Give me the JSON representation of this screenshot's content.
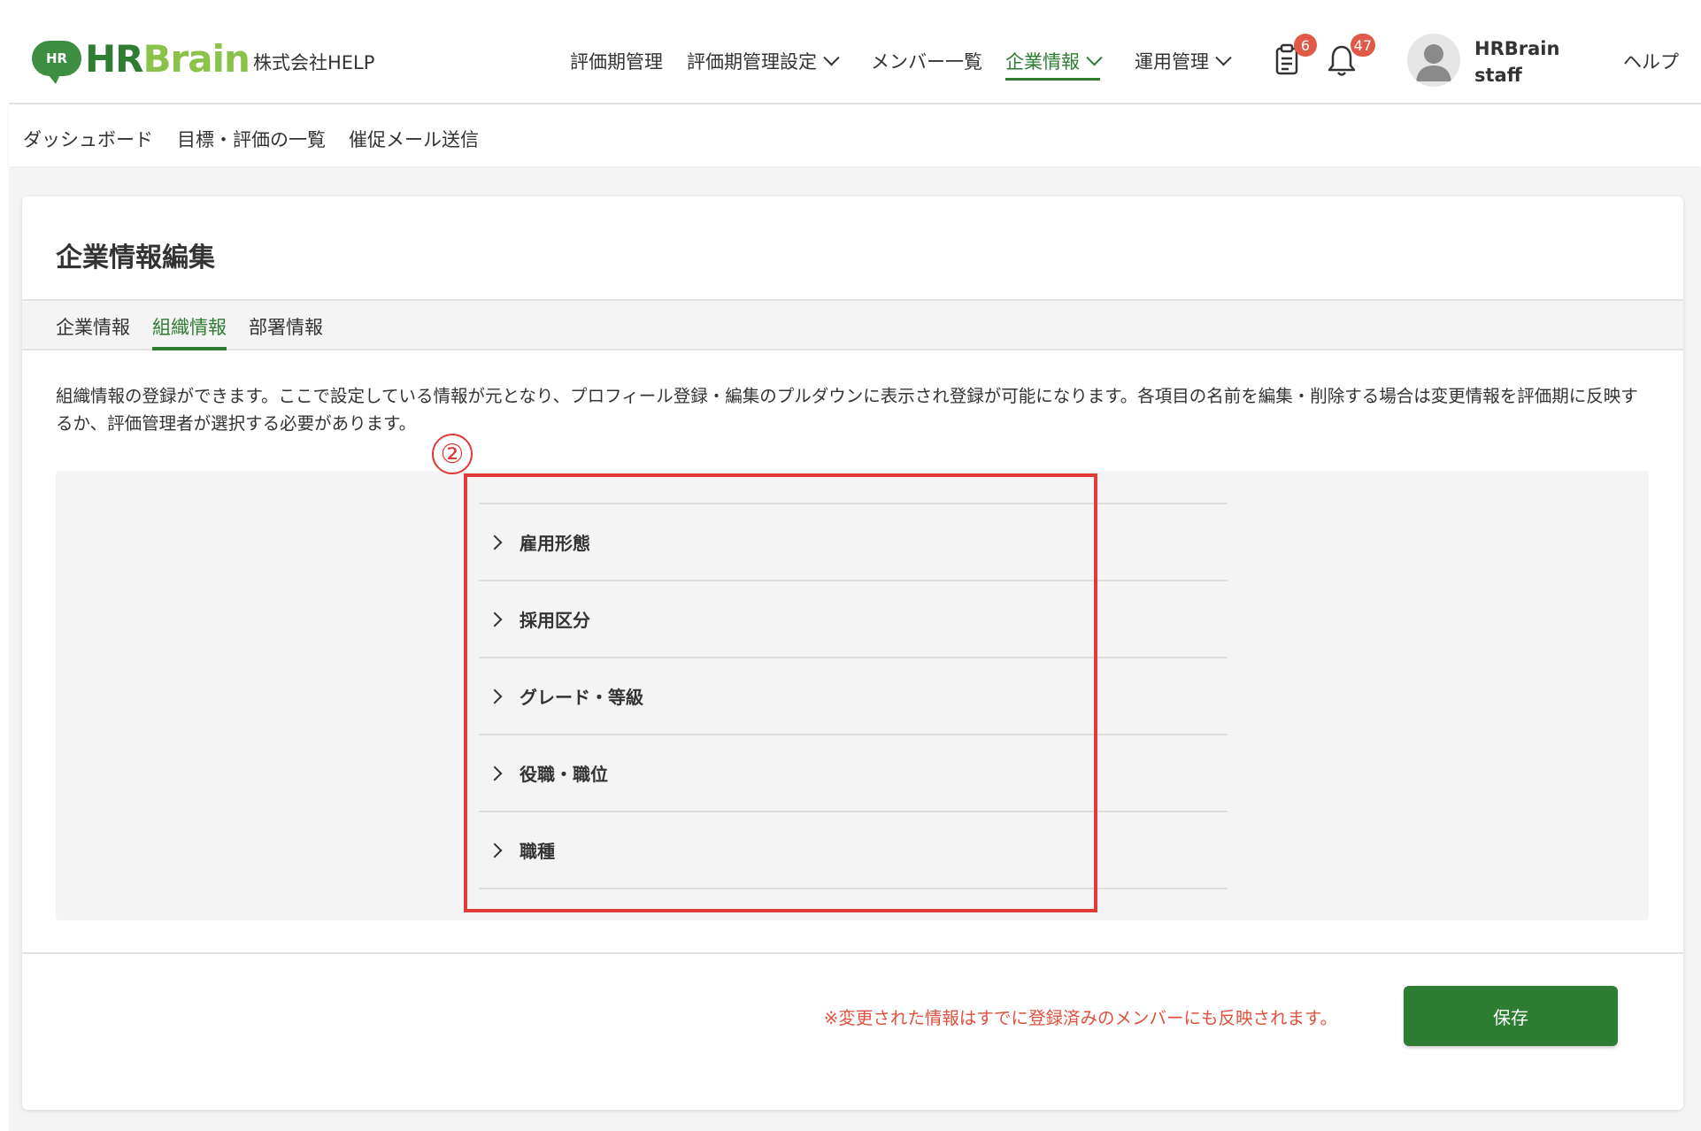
{
  "header": {
    "logo": {
      "badge": "HR",
      "hr": "HR",
      "brain": "Brain"
    },
    "company": "株式会社HELP",
    "nav": [
      {
        "label": "評価期管理"
      },
      {
        "label": "評価期管理設定"
      },
      {
        "label": "メンバー一覧"
      },
      {
        "label": "企業情報"
      },
      {
        "label": "運用管理"
      }
    ],
    "tasks_badge": "6",
    "notifications_badge": "47",
    "user": {
      "line1": "HRBrain",
      "line2": "staff"
    },
    "help": "ヘルプ"
  },
  "subnav": [
    "ダッシュボード",
    "目標・評価の一覧",
    "催促メール送信"
  ],
  "card": {
    "title": "企業情報編集",
    "tabs": [
      "企業情報",
      "組織情報",
      "部署情報"
    ],
    "active_tab": "組織情報",
    "description": "組織情報の登録ができます。ここで設定している情報が元となり、プロフィール登録・編集のプルダウンに表示され登録が可能になります。各項目の名前を編集・削除する場合は変更情報を評価期に反映するか、評価管理者が選択する必要があります。",
    "items": [
      "雇用形態",
      "採用区分",
      "グレード・等級",
      "役職・職位",
      "職種"
    ],
    "annotation": "②",
    "note": "※変更された情報はすでに登録済みのメンバーにも反映されます。",
    "save": "保存"
  },
  "colors": {
    "brand_green": "#2e7d32",
    "logo_light_green": "#8bc34a",
    "badge_red": "#e05a47",
    "annotation_red": "#e03b36",
    "note_red": "#e0503f"
  }
}
